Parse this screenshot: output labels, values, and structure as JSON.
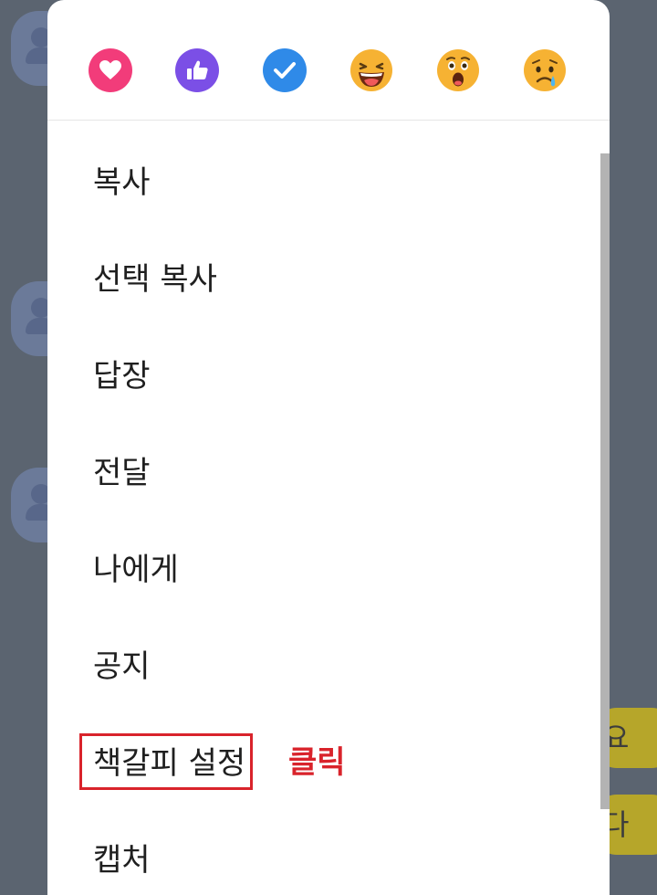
{
  "reactions": [
    {
      "name": "heart",
      "color": "#f23c7a"
    },
    {
      "name": "thumbs-up",
      "color": "#7b4fe6"
    },
    {
      "name": "check",
      "color": "#2f8ae8"
    },
    {
      "name": "laughing-face",
      "color": "#f6b233"
    },
    {
      "name": "surprised-face",
      "color": "#f6b233"
    },
    {
      "name": "sad-face",
      "color": "#f6b233"
    }
  ],
  "menu": {
    "items": [
      {
        "label": "복사"
      },
      {
        "label": "선택 복사"
      },
      {
        "label": "답장"
      },
      {
        "label": "전달"
      },
      {
        "label": "나에게"
      },
      {
        "label": "공지"
      },
      {
        "label": "책갈피 설정"
      },
      {
        "label": "캡처"
      }
    ]
  },
  "annotation": {
    "click_label": "클릭",
    "color": "#d9232b"
  },
  "background": {
    "bubbles": [
      "요",
      "다"
    ]
  }
}
